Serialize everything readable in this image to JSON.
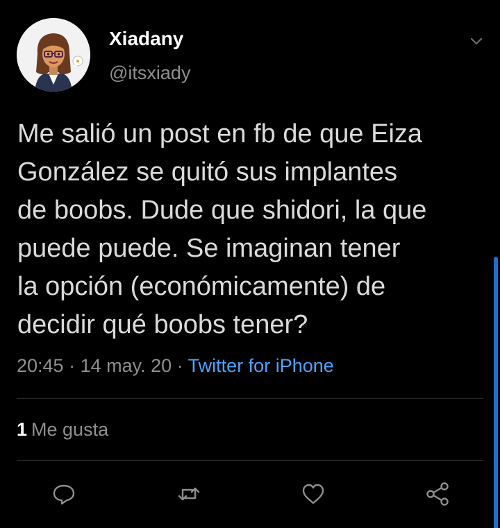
{
  "author": {
    "display_name": "Xiadany",
    "handle": "@itsxiady",
    "avatar_icon": "bitmoji-avatar"
  },
  "tweet": {
    "text": "Me salió un post en fb de que Eiza\nGonzález se quitó sus implantes\nde boobs. Dude que shidori, la que\npuede puede. Se imaginan tener\nla opción (económicamente) de\ndecidir qué boobs tener?",
    "time": "20:45",
    "separator1": " · ",
    "date": "14 may. 20",
    "separator2": " · ",
    "source": "Twitter for iPhone"
  },
  "stats": {
    "likes_count": "1",
    "likes_label": "Me gusta"
  },
  "actions": {
    "reply_icon": "reply-icon",
    "retweet_icon": "retweet-icon",
    "like_icon": "heart-icon",
    "share_icon": "share-icon"
  },
  "colors": {
    "background": "#000000",
    "text": "#dadada",
    "secondary": "#8f8f8f",
    "link": "#4da3ff",
    "scrollbar": "#1e6fd0"
  }
}
